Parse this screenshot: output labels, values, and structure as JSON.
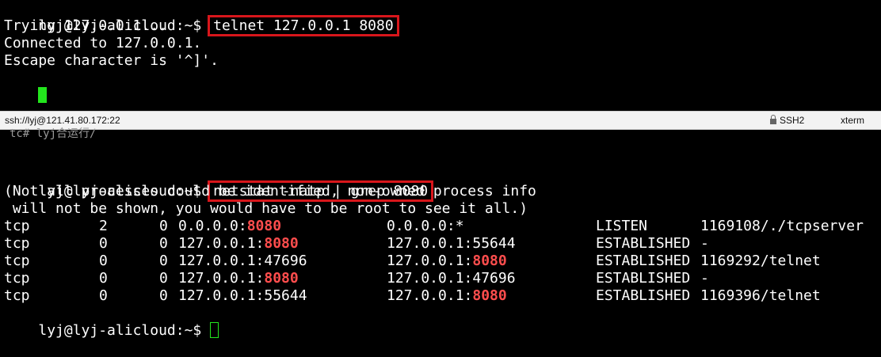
{
  "terminal_top": {
    "prompt": "lyj@lyj-alicloud:~$",
    "command": "telnet 127.0.0.1 8080",
    "output": [
      "Trying 127.0.0.1...",
      "Connected to 127.0.0.1.",
      "Escape character is '^]'."
    ]
  },
  "statusbar": {
    "session": "ssh://lyj@121.41.80.172:22",
    "protocol": "SSH2",
    "terminal_type": "xterm"
  },
  "ghost_text": "tc#  lyj合运行/",
  "terminal_bottom": {
    "prompt": "lyj@lyj-alicloud:~$",
    "command": "netstat -natp | grep 8080",
    "notice": [
      "(Not all processes could be identified, non-owned process info",
      " will not be shown, you would have to be root to see it all.)"
    ],
    "rows": [
      {
        "proto": "tcp",
        "recvq": "2",
        "sendq": "0",
        "local_pre": "0.0.0.0:",
        "local_hl": "8080",
        "foreign_pre": "0.0.0.0:*",
        "foreign_hl": "",
        "state": "LISTEN",
        "program": "1169108/./tcpserver"
      },
      {
        "proto": "tcp",
        "recvq": "0",
        "sendq": "0",
        "local_pre": "127.0.0.1:",
        "local_hl": "8080",
        "foreign_pre": "127.0.0.1:55644",
        "foreign_hl": "",
        "state": "ESTABLISHED",
        "program": "-"
      },
      {
        "proto": "tcp",
        "recvq": "0",
        "sendq": "0",
        "local_pre": "127.0.0.1:47696",
        "local_hl": "",
        "foreign_pre": "127.0.0.1:",
        "foreign_hl": "8080",
        "state": "ESTABLISHED",
        "program": "1169292/telnet"
      },
      {
        "proto": "tcp",
        "recvq": "0",
        "sendq": "0",
        "local_pre": "127.0.0.1:",
        "local_hl": "8080",
        "foreign_pre": "127.0.0.1:47696",
        "foreign_hl": "",
        "state": "ESTABLISHED",
        "program": "-"
      },
      {
        "proto": "tcp",
        "recvq": "0",
        "sendq": "0",
        "local_pre": "127.0.0.1:55644",
        "local_hl": "",
        "foreign_pre": "127.0.0.1:",
        "foreign_hl": "8080",
        "state": "ESTABLISHED",
        "program": "1169396/telnet"
      }
    ],
    "final_prompt": "lyj@lyj-alicloud:~$"
  },
  "colors": {
    "highlight_box": "#d8161b",
    "port_highlight": "#ff4d4d",
    "cursor": "#23e61d"
  }
}
